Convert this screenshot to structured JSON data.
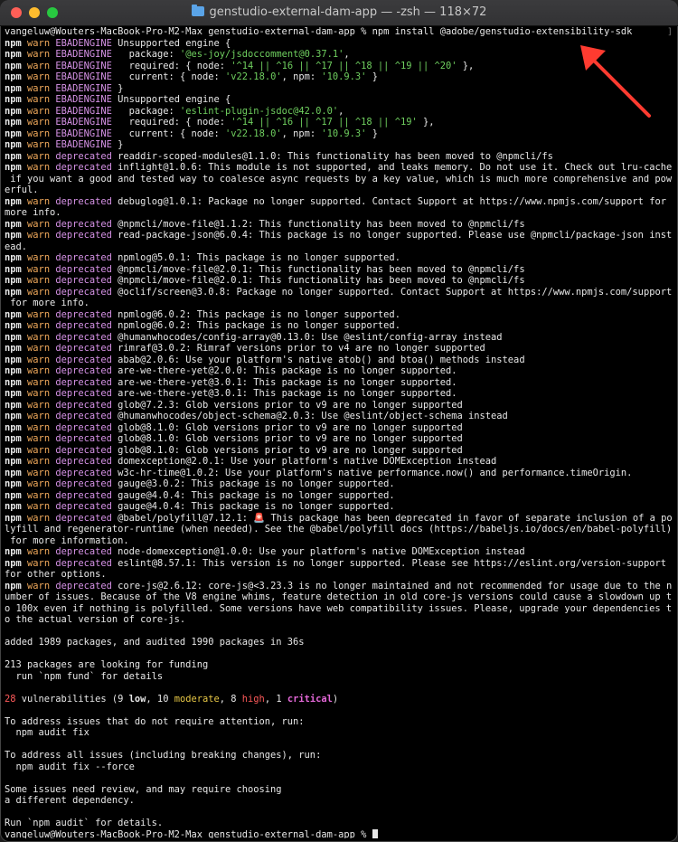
{
  "window": {
    "title": "genstudio-external-dam-app — -zsh — 118×72",
    "accent": "#ff3b30"
  },
  "terminal": {
    "lines": [
      "vangeluw@Wouters-MacBook-Pro-M2-Max genstudio-external-dam-app % npm install @adobe/genstudio-extensibility-sdk",
      "npm warn EBADENGINE Unsupported engine {",
      "npm warn EBADENGINE   package: '@es-joy/jsdoccomment@0.37.1',",
      "npm warn EBADENGINE   required: { node: '^14 || ^16 || ^17 || ^18 || ^19 || ^20' },",
      "npm warn EBADENGINE   current: { node: 'v22.18.0', npm: '10.9.3' }",
      "npm warn EBADENGINE }",
      "npm warn EBADENGINE Unsupported engine {",
      "npm warn EBADENGINE   package: 'eslint-plugin-jsdoc@42.0.0',",
      "npm warn EBADENGINE   required: { node: '^14 || ^16 || ^17 || ^18 || ^19' },",
      "npm warn EBADENGINE   current: { node: 'v22.18.0', npm: '10.9.3' }",
      "npm warn EBADENGINE }",
      "npm warn deprecated readdir-scoped-modules@1.1.0: This functionality has been moved to @npmcli/fs",
      "npm warn deprecated inflight@1.0.6: This module is not supported, and leaks memory. Do not use it. Check out lru-cache",
      " if you want a good and tested way to coalesce async requests by a key value, which is much more comprehensive and pow",
      "erful.",
      "npm warn deprecated debuglog@1.0.1: Package no longer supported. Contact Support at https://www.npmjs.com/support for",
      "more info.",
      "npm warn deprecated @npmcli/move-file@1.1.2: This functionality has been moved to @npmcli/fs",
      "npm warn deprecated read-package-json@6.0.4: This package is no longer supported. Please use @npmcli/package-json inst",
      "ead.",
      "npm warn deprecated npmlog@5.0.1: This package is no longer supported.",
      "npm warn deprecated @npmcli/move-file@2.0.1: This functionality has been moved to @npmcli/fs",
      "npm warn deprecated @npmcli/move-file@2.0.1: This functionality has been moved to @npmcli/fs",
      "npm warn deprecated @oclif/screen@3.0.8: Package no longer supported. Contact Support at https://www.npmjs.com/support",
      " for more info.",
      "npm warn deprecated npmlog@6.0.2: This package is no longer supported.",
      "npm warn deprecated npmlog@6.0.2: This package is no longer supported.",
      "npm warn deprecated @humanwhocodes/config-array@0.13.0: Use @eslint/config-array instead",
      "npm warn deprecated rimraf@3.0.2: Rimraf versions prior to v4 are no longer supported",
      "npm warn deprecated abab@2.0.6: Use your platform's native atob() and btoa() methods instead",
      "npm warn deprecated are-we-there-yet@2.0.0: This package is no longer supported.",
      "npm warn deprecated are-we-there-yet@3.0.1: This package is no longer supported.",
      "npm warn deprecated are-we-there-yet@3.0.1: This package is no longer supported.",
      "npm warn deprecated glob@7.2.3: Glob versions prior to v9 are no longer supported",
      "npm warn deprecated @humanwhocodes/object-schema@2.0.3: Use @eslint/object-schema instead",
      "npm warn deprecated glob@8.1.0: Glob versions prior to v9 are no longer supported",
      "npm warn deprecated glob@8.1.0: Glob versions prior to v9 are no longer supported",
      "npm warn deprecated glob@8.1.0: Glob versions prior to v9 are no longer supported",
      "npm warn deprecated domexception@2.0.1: Use your platform's native DOMException instead",
      "npm warn deprecated w3c-hr-time@1.0.2: Use your platform's native performance.now() and performance.timeOrigin.",
      "npm warn deprecated gauge@3.0.2: This package is no longer supported.",
      "npm warn deprecated gauge@4.0.4: This package is no longer supported.",
      "npm warn deprecated gauge@4.0.4: This package is no longer supported.",
      "npm warn deprecated @babel/polyfill@7.12.1: 🚨 This package has been deprecated in favor of separate inclusion of a po",
      "lyfill and regenerator-runtime (when needed). See the @babel/polyfill docs (https://babeljs.io/docs/en/babel-polyfill)",
      " for more information.",
      "npm warn deprecated node-domexception@1.0.0: Use your platform's native DOMException instead",
      "npm warn deprecated eslint@8.57.1: This version is no longer supported. Please see https://eslint.org/version-support",
      "for other options.",
      "npm warn deprecated core-js@2.6.12: core-js@<3.23.3 is no longer maintained and not recommended for usage due to the n",
      "umber of issues. Because of the V8 engine whims, feature detection in old core-js versions could cause a slowdown up t",
      "o 100x even if nothing is polyfilled. Some versions have web compatibility issues. Please, upgrade your dependencies t",
      "o the actual version of core-js.",
      "",
      "added 1989 packages, and audited 1990 packages in 36s",
      "",
      "213 packages are looking for funding",
      "  run `npm fund` for details",
      "",
      "28 vulnerabilities (9 low, 10 moderate, 8 high, 1 critical)",
      "",
      "To address issues that do not require attention, run:",
      "  npm audit fix",
      "",
      "To address all issues (including breaking changes), run:",
      "  npm audit fix --force",
      "",
      "Some issues need review, and may require choosing",
      "a different dependency.",
      "",
      "Run `npm audit` for details.",
      "vangeluw@Wouters-MacBook-Pro-M2-Max genstudio-external-dam-app % "
    ]
  }
}
